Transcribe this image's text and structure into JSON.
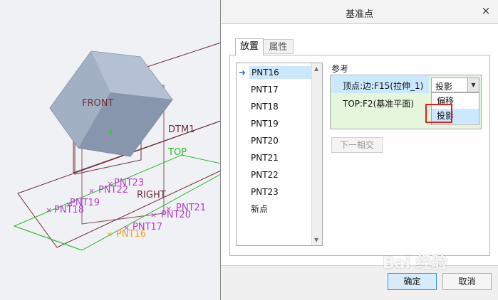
{
  "viewport": {
    "labels": {
      "front": "FRONT",
      "dtm1": "DTM1",
      "top": "TOP",
      "right": "RIGHT",
      "pnt23": "PNT23",
      "pnt22": "PNT22",
      "pnt19": "PNT19",
      "pnt18": "PNT18",
      "pnt21": "PNT21",
      "pnt20": "PNT20",
      "pnt17": "PNT17",
      "pnt16": "PNT16"
    },
    "colors": {
      "datum_plane": "#6e2f3a",
      "top_plane": "#2fb52f",
      "point_label": "#b040c8",
      "selected_point": "#f0a020",
      "solid": "#9aa8bc"
    }
  },
  "dialog": {
    "title": "基准点",
    "close_glyph": "×",
    "tabs": [
      {
        "label": "放置"
      },
      {
        "label": "属性"
      }
    ],
    "points": [
      "PNT16",
      "PNT17",
      "PNT18",
      "PNT19",
      "PNT20",
      "PNT21",
      "PNT22",
      "PNT23",
      "新点"
    ],
    "reference_label": "参考",
    "references": [
      {
        "text": "顶点:边:F15(拉伸_1)",
        "constraint": "投影"
      },
      {
        "text": "TOP:F2(基准平面)"
      }
    ],
    "dropdown_options": [
      "偏移",
      "投影"
    ],
    "next_button": "下一相交",
    "ok_button": "确定",
    "cancel_button": "取消"
  },
  "watermark": "Bai 经验"
}
